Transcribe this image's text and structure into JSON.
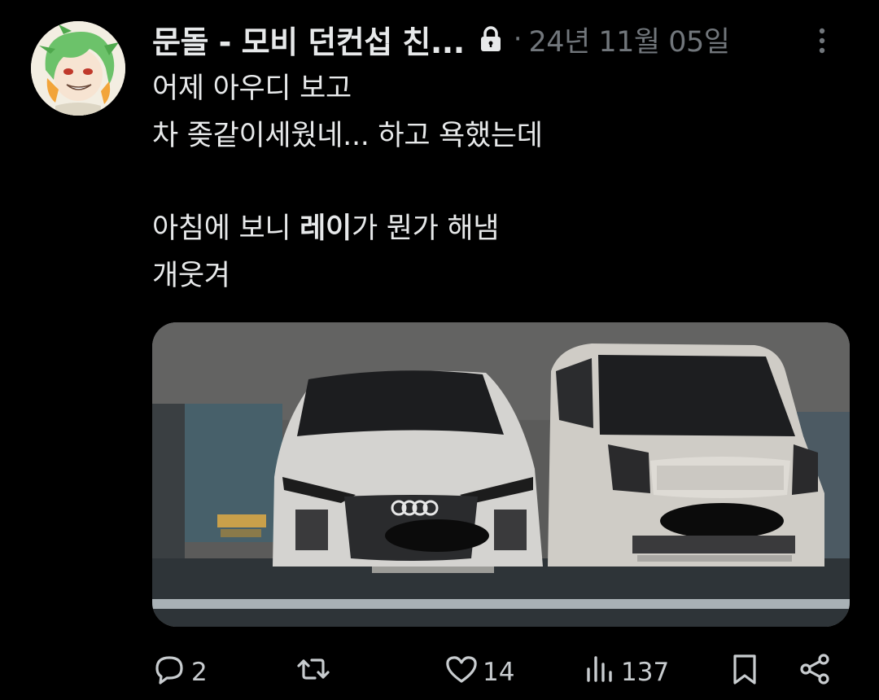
{
  "author": {
    "display_name": "문돌 - 모비 던컨섭 친...",
    "protected": true,
    "separator": "·",
    "timestamp": "24년 11월 05일"
  },
  "tweet": {
    "lines": [
      "어제 아우디 보고",
      "차 좆같이세웠네... 하고 욕했는데",
      "",
      "아침에 보니 ",
      "레이",
      "가 뭔가 해냄",
      "개웃겨"
    ]
  },
  "media": {
    "alt": "photo",
    "colors": {
      "wall": "#5e5e5e",
      "car": "#d7d5d1"
    }
  },
  "actions": {
    "reply_count": "2",
    "retweet_count": "",
    "like_count": "14",
    "view_count": "137"
  },
  "icons": [
    "lock-icon",
    "more-icon",
    "reply-icon",
    "retweet-icon",
    "like-icon",
    "views-icon",
    "bookmark-icon",
    "share-icon"
  ]
}
